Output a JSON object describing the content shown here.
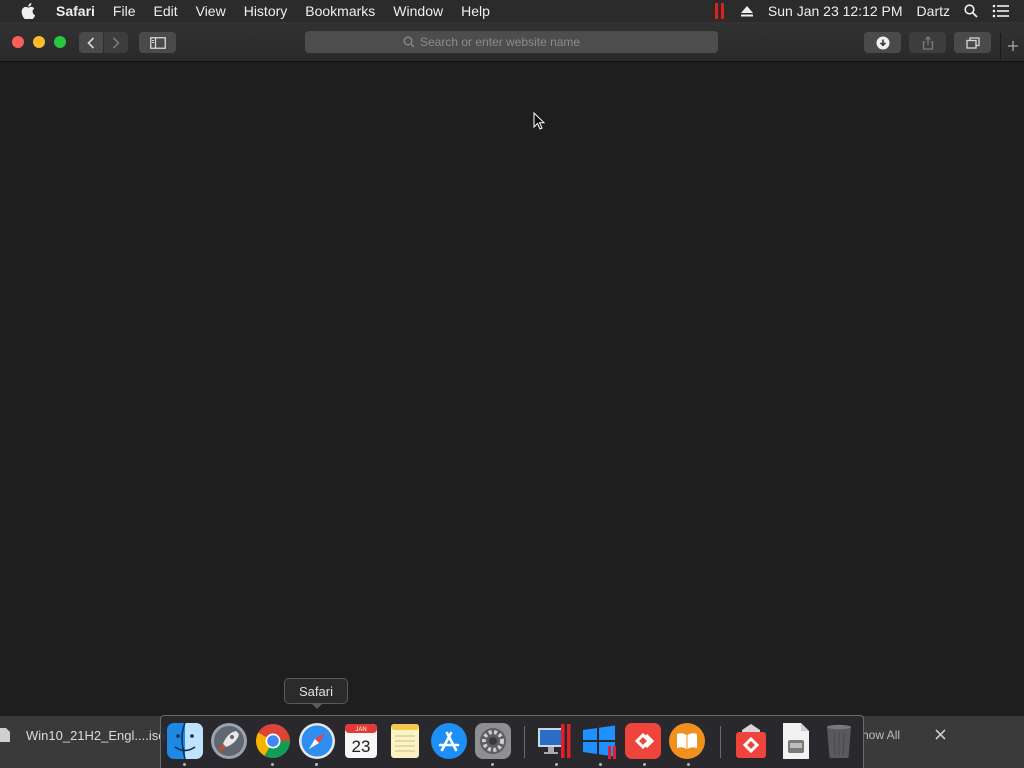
{
  "menubar": {
    "apple_icon": "apple-icon",
    "app_name": "Safari",
    "items": [
      "File",
      "Edit",
      "View",
      "History",
      "Bookmarks",
      "Window",
      "Help"
    ],
    "clock": "Sun Jan 23  12:12 PM",
    "user": "Dartz"
  },
  "toolbar": {
    "address_placeholder": "Search or enter website name"
  },
  "downloads": {
    "file_name": "Win10_21H2_Engl....iso",
    "show_all": "how All"
  },
  "dock": {
    "tooltip": "Safari",
    "apps": [
      "Finder",
      "Launchpad",
      "Google Chrome",
      "Safari",
      "Calendar",
      "Notes",
      "App Store",
      "System Preferences",
      "Parallels Desktop",
      "Windows",
      "AnyDesk",
      "Books",
      "AnyDesk Installer",
      "Preview",
      "Trash"
    ],
    "calendar_month": "JAN",
    "calendar_day": "23"
  },
  "colors": {
    "close": "#fc5f57",
    "minimize": "#fdbc2e",
    "maximize": "#28c840",
    "background": "#1e1e1e"
  }
}
